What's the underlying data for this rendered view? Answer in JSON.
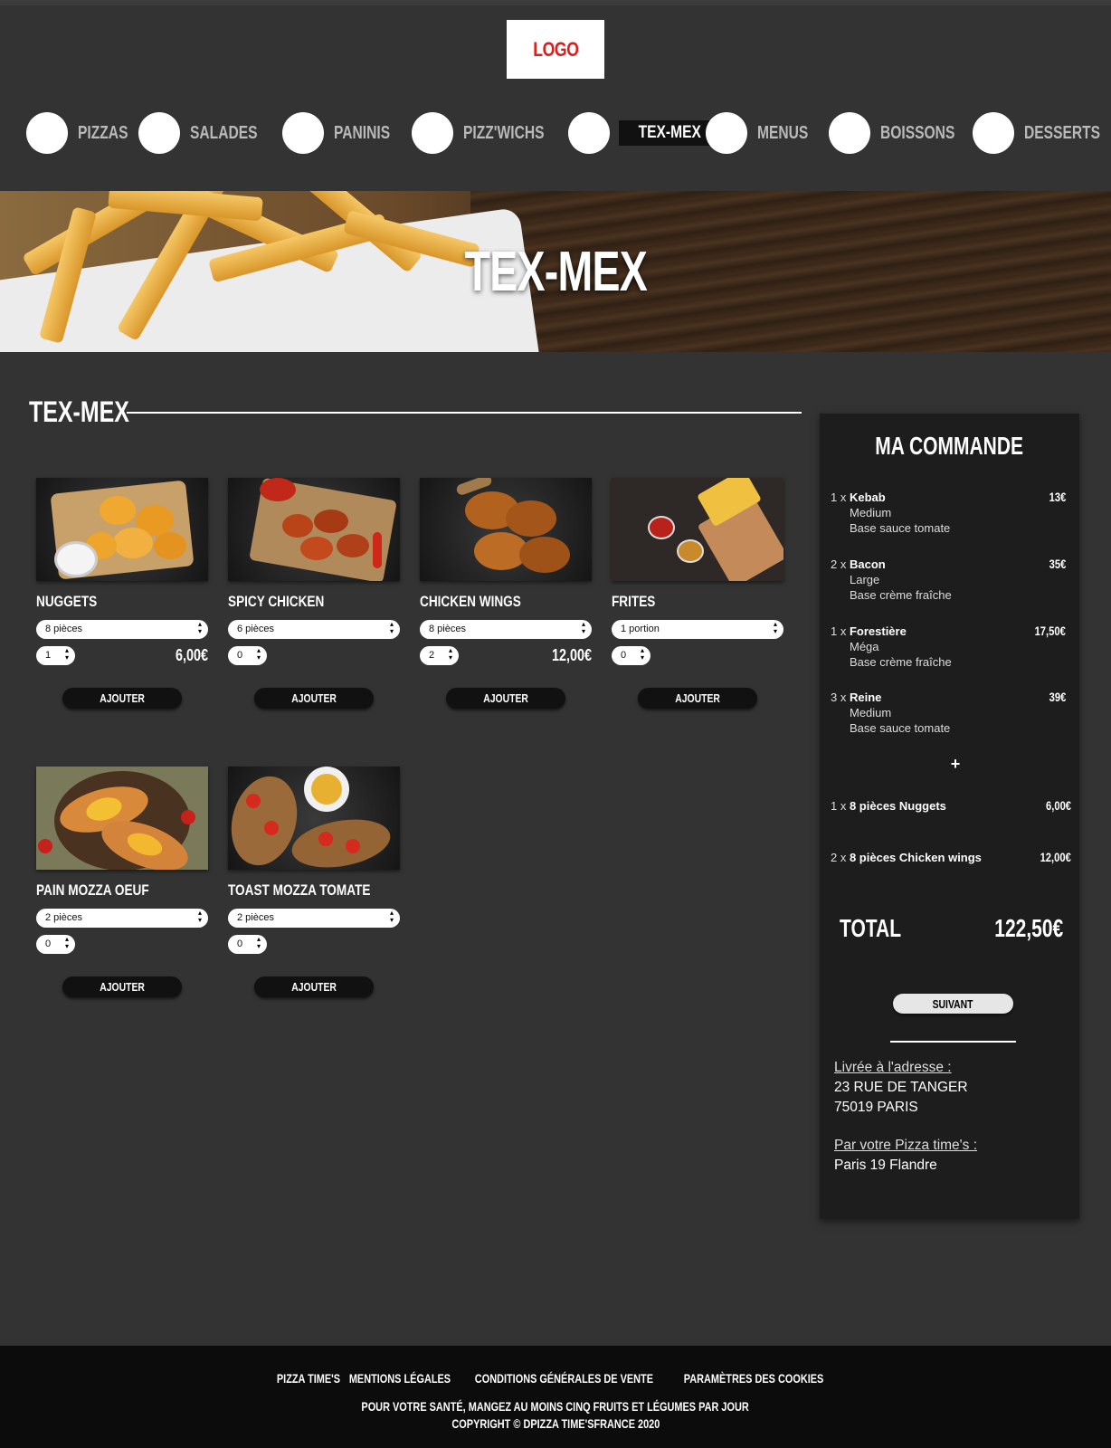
{
  "logo": "LOGO",
  "nav": [
    {
      "label": "PIZZAS",
      "active": false
    },
    {
      "label": "SALADES",
      "active": false
    },
    {
      "label": "PANINIS",
      "active": false
    },
    {
      "label": "PIZZ'WICHS",
      "active": false
    },
    {
      "label": "TEX-MEX",
      "active": true
    },
    {
      "label": "MENUS",
      "active": false
    },
    {
      "label": "BOISSONS",
      "active": false
    },
    {
      "label": "DESSERTS",
      "active": false
    }
  ],
  "banner": {
    "title": "TEX-MEX"
  },
  "section": {
    "title": "TEX-MEX"
  },
  "products": [
    {
      "name": "NUGGETS",
      "option": "8 pièces",
      "qty": "1",
      "price": "6,00€",
      "add": "AJOUTER"
    },
    {
      "name": "SPICY CHICKEN",
      "option": "6 pièces",
      "qty": "0",
      "price": "",
      "add": "AJOUTER"
    },
    {
      "name": "CHICKEN WINGS",
      "option": "8 pièces",
      "qty": "2",
      "price": "12,00€",
      "add": "AJOUTER"
    },
    {
      "name": "FRITES",
      "option": "1 portion",
      "qty": "0",
      "price": "",
      "add": "AJOUTER"
    },
    {
      "name": "PAIN MOZZA OEUF",
      "option": "2 pièces",
      "qty": "0",
      "price": "",
      "add": "AJOUTER"
    },
    {
      "name": "TOAST MOZZA TOMATE",
      "option": "2 pièces",
      "qty": "0",
      "price": "",
      "add": "AJOUTER"
    }
  ],
  "order": {
    "title": "MA COMMANDE",
    "lines": [
      {
        "qty": "1 x",
        "name": "Kebab",
        "details": [
          "Medium",
          "Base sauce tomate"
        ],
        "price": "13€"
      },
      {
        "qty": "2 x",
        "name": "Bacon",
        "details": [
          "Large",
          "Base crème fraîche"
        ],
        "price": "35€"
      },
      {
        "qty": "1 x",
        "name": "Forestière",
        "details": [
          "Méga",
          "Base crème fraîche"
        ],
        "price": "17,50€"
      },
      {
        "qty": "3 x",
        "name": "Reine",
        "details": [
          "Medium",
          "Base sauce tomate"
        ],
        "price": "39€"
      }
    ],
    "plus": "+",
    "extras": [
      {
        "qty": "1 x",
        "name": "8 pièces Nuggets",
        "price": "6,00€"
      },
      {
        "qty": "2 x",
        "name": "8 pièces Chicken wings",
        "price": "12,00€"
      }
    ],
    "total_label": "TOTAL",
    "total_value": "122,50€",
    "next_label": "SUIVANT",
    "address_label": "Livrée à l'adresse :",
    "address_line1": "23 RUE DE TANGER",
    "address_line2": "75019 PARIS",
    "store_label": "Par votre Pizza time's :",
    "store_name": "Paris 19 Flandre"
  },
  "footer": {
    "links": [
      "PIZZA TIME'S",
      "MENTIONS LÉGALES",
      "CONDITIONS GÉNÉRALES DE VENTE",
      "PARAMÈTRES DES COOKIES"
    ],
    "health": "POUR VOTRE SANTÉ, MANGEZ AU MOINS CINQ FRUITS ET LÉGUMES PAR JOUR",
    "copyright": "COPYRIGHT © DPIZZA TIME'SFRANCE 2020"
  }
}
